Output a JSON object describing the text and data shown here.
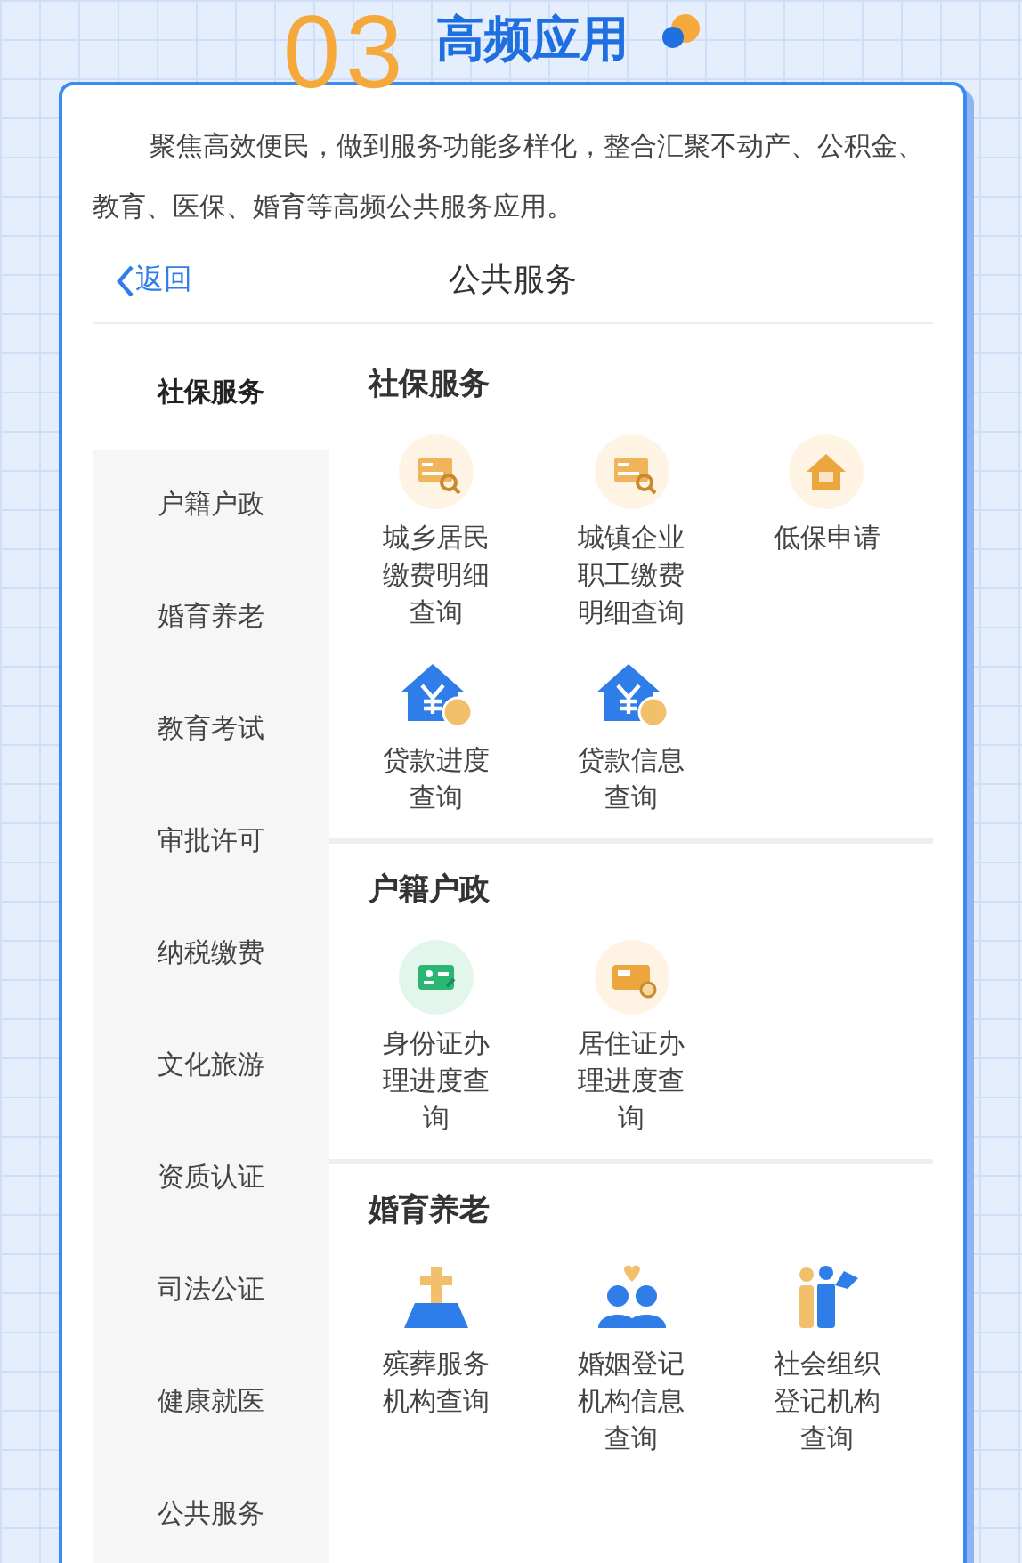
{
  "header": {
    "number": "03",
    "title": "高频应用"
  },
  "intro": "聚焦高效便民，做到服务功能多样化，整合汇聚不动产、公积金、教育、医保、婚育等高频公共服务应用。",
  "nav": {
    "back": "返回",
    "title": "公共服务"
  },
  "sidebar": {
    "items": [
      {
        "label": "社保服务",
        "selected": true
      },
      {
        "label": "户籍户政",
        "selected": false
      },
      {
        "label": "婚育养老",
        "selected": false
      },
      {
        "label": "教育考试",
        "selected": false
      },
      {
        "label": "审批许可",
        "selected": false
      },
      {
        "label": "纳税缴费",
        "selected": false
      },
      {
        "label": "文化旅游",
        "selected": false
      },
      {
        "label": "资质认证",
        "selected": false
      },
      {
        "label": "司法公证",
        "selected": false
      },
      {
        "label": "健康就医",
        "selected": false
      },
      {
        "label": "公共服务",
        "selected": false
      }
    ]
  },
  "sections": [
    {
      "title": "社保服务",
      "items": [
        {
          "label": "城乡居民缴费明细查询",
          "kind": "payment-search"
        },
        {
          "label": "城镇企业职工缴费明细查询",
          "kind": "payment-search"
        },
        {
          "label": "低保申请",
          "kind": "house-orange"
        },
        {
          "label": "贷款进度查询",
          "kind": "house-loan"
        },
        {
          "label": "贷款信息查询",
          "kind": "house-loan"
        }
      ]
    },
    {
      "title": "户籍户政",
      "items": [
        {
          "label": "身份证办理进度查询",
          "kind": "id-card"
        },
        {
          "label": "居住证办理进度查询",
          "kind": "residence-card"
        }
      ]
    },
    {
      "title": "婚育养老",
      "items": [
        {
          "label": "殡葬服务机构查询",
          "kind": "grave"
        },
        {
          "label": "婚姻登记机构信息查询",
          "kind": "couple"
        },
        {
          "label": "社会组织登记机构查询",
          "kind": "group-flag"
        }
      ]
    }
  ]
}
